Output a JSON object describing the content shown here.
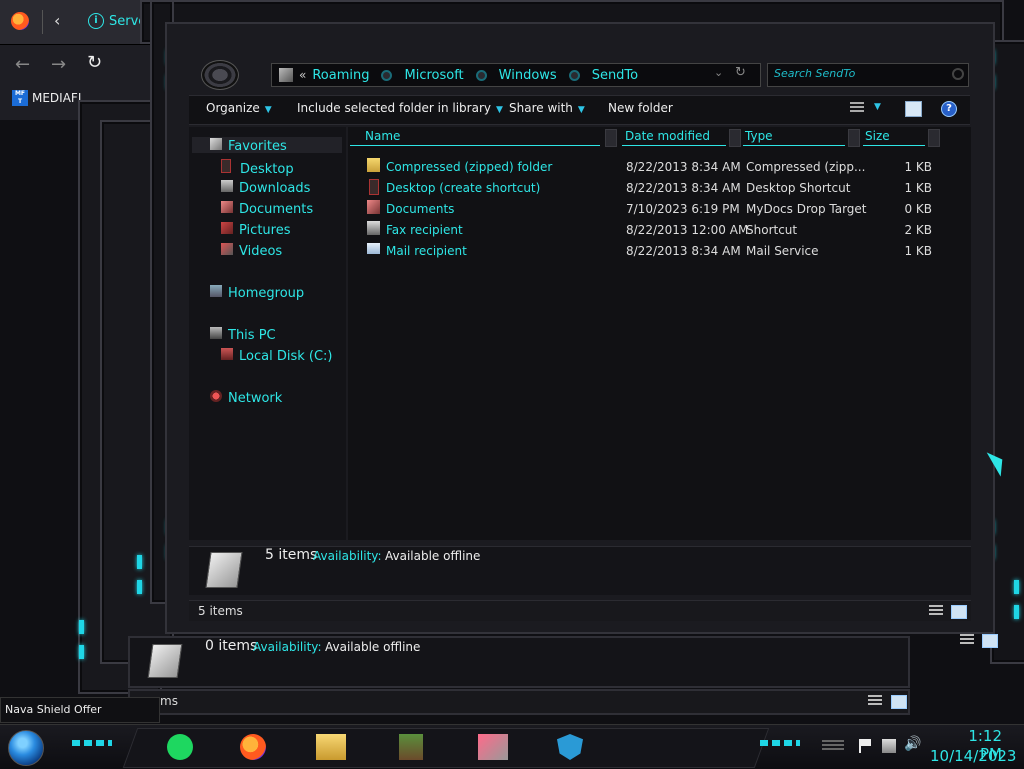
{
  "browser": {
    "tab_title": "Serve",
    "bookmark_label": "MEDIAFI",
    "bookmark_badge": "MF T"
  },
  "explorer": {
    "breadcrumb": [
      "Roaming",
      "Microsoft",
      "Windows",
      "SendTo"
    ],
    "breadcrumb_prefix": "«",
    "search_placeholder": "Search SendTo",
    "toolbar": {
      "organize": "Organize",
      "include": "Include selected folder in library",
      "share": "Share with",
      "new_folder": "New folder"
    },
    "nav": {
      "favorites": "Favorites",
      "desktop": "Desktop",
      "downloads": "Downloads",
      "documents": "Documents",
      "pictures": "Pictures",
      "videos": "Videos",
      "homegroup": "Homegroup",
      "this_pc": "This PC",
      "local_disk": "Local Disk (C:)",
      "network": "Network"
    },
    "columns": {
      "name": "Name",
      "date": "Date modified",
      "type": "Type",
      "size": "Size"
    },
    "files": [
      {
        "name": "Compressed (zipped) folder",
        "date": "8/22/2013 8:34 AM",
        "type": "Compressed (zipp...",
        "size": "1 KB"
      },
      {
        "name": "Desktop (create shortcut)",
        "date": "8/22/2013 8:34 AM",
        "type": "Desktop Shortcut",
        "size": "1 KB"
      },
      {
        "name": "Documents",
        "date": "7/10/2023 6:19 PM",
        "type": "MyDocs Drop Target",
        "size": "0 KB"
      },
      {
        "name": "Fax recipient",
        "date": "8/22/2013 12:00 AM",
        "type": "Shortcut",
        "size": "2 KB"
      },
      {
        "name": "Mail recipient",
        "date": "8/22/2013 8:34 AM",
        "type": "Mail Service",
        "size": "1 KB"
      }
    ],
    "details": {
      "count": "5 items",
      "availability_label": "Availability:",
      "availability_value": "Available offline"
    },
    "status": "5 items"
  },
  "back_window": {
    "count": "0 items",
    "availability_label": "Availability:",
    "availability_value": "Available offline",
    "status": "ms"
  },
  "toast": "Nava Shield Offer",
  "clock": {
    "time": "1:12 PM",
    "date": "10/14/2023"
  },
  "colors": {
    "accent": "#2ee6e6",
    "led": "#1fd6e6",
    "background": "#0f0f13"
  }
}
